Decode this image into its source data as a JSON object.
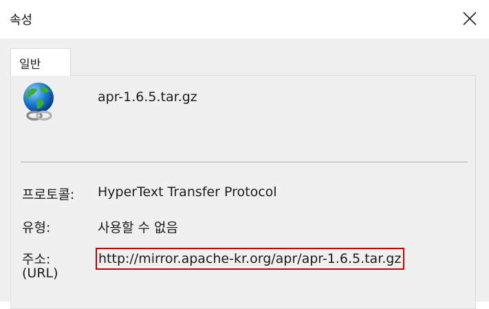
{
  "window": {
    "title": "속성"
  },
  "tabs": [
    {
      "label": "일반",
      "active": true
    }
  ],
  "file": {
    "icon": "internet-shortcut-globe-chain-icon",
    "name": "apr-1.6.5.tar.gz"
  },
  "properties": {
    "protocol": {
      "label": "프로토콜:",
      "value": "HyperText Transfer Protocol"
    },
    "type": {
      "label": "유형:",
      "value": "사용할 수 없음"
    },
    "address": {
      "label": "주소:",
      "label_sub": "(URL)",
      "value": "http://mirror.apache-kr.org/apr/apr-1.6.5.tar.gz",
      "highlight_color": "#c00000"
    }
  },
  "colors": {
    "dialog_bg": "#f0f0f0",
    "titlebar_bg": "#ffffff"
  }
}
